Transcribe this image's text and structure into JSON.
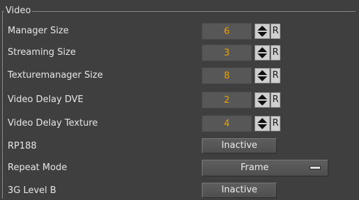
{
  "group": {
    "title": "Video"
  },
  "rows": [
    {
      "label": "Manager Size",
      "value": "6",
      "reset": "R"
    },
    {
      "label": "Streaming Size",
      "value": "3",
      "reset": "R"
    },
    {
      "label": "Texturemanager Size",
      "value": "8",
      "reset": "R"
    },
    {
      "label": "Video Delay DVE",
      "value": "2",
      "reset": "R"
    },
    {
      "label": "Video Delay Texture",
      "value": "4",
      "reset": "R"
    }
  ],
  "rp188": {
    "label": "RP188",
    "button": "Inactive"
  },
  "repeat_mode": {
    "label": "Repeat Mode",
    "value": "Frame"
  },
  "level_b": {
    "label": "3G Level B",
    "button": "Inactive"
  },
  "colors": {
    "value_text": "#e8a100",
    "panel_bg": "#3f3f3f"
  },
  "icons": {
    "spin": "up-down-arrows-icon",
    "dropdown": "dropdown-handle-icon"
  }
}
